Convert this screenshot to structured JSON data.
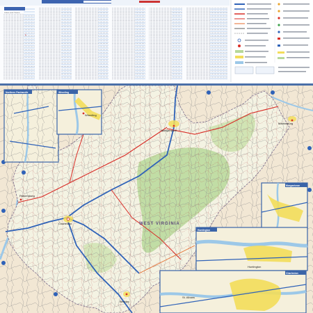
{
  "header": {
    "index_title": "Index",
    "index_subtitle": "Cities and Towns",
    "legend_items": [
      "Interstate Highway",
      "U.S. Highway",
      "State Highway",
      "County Seat",
      "State Capital",
      "Airport",
      "Point of Interest",
      "State Park",
      "National Forest"
    ]
  },
  "map": {
    "state_label": "WEST VIRGINIA",
    "inset_labels": [
      "Northern Panhandle",
      "Wheeling",
      "Morgantown",
      "Huntington",
      "Charleston"
    ],
    "city_labels": [
      "Wheeling",
      "Morgantown",
      "Martinsburg",
      "Parkersburg",
      "Huntington",
      "Charleston",
      "Beckley",
      "St. Albans"
    ],
    "colors": {
      "land_wv": "#f4f3e3",
      "land_other": "#f2e7d4",
      "forest": "#b7d89a",
      "water": "#9cc8e8",
      "interstate": "#2f62b8",
      "us_highway": "#d92d27",
      "state_road": "#222222",
      "urban": "#f3dd5a",
      "inset_border": "#3a64a8"
    }
  }
}
